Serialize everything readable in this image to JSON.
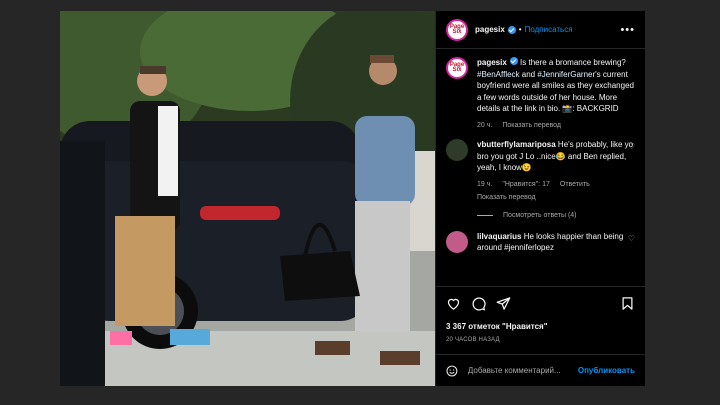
{
  "post": {
    "username": "pagesix",
    "avatar_text": "Page Six",
    "follow_label": "Подписаться",
    "more_label": "•••",
    "separator": "•",
    "caption": {
      "username": "pagesix",
      "t1": " Is there a bromance brewing? ",
      "tag1": "#BenAffleck",
      "t2": " and ",
      "tag2": "#JenniferGarner",
      "t3": "'s current boyfriend were all smiles as they exchanged a few words outside of her house. More details at the link in bio. 📸: BACKGRID",
      "time": "20 ч.",
      "translate": "Показать перевод"
    },
    "comments": [
      {
        "username": "vbutterflylamariposa",
        "text": " He's probably, like yo bro you got J Lo ..nice😂 and Ben replied, yeah, I know😉",
        "time": "19 ч.",
        "likes": "\"Нравится\": 17",
        "reply": "Ответить",
        "translate": "Показать перевод",
        "view_replies": "Посмотреть ответы (4)",
        "avatar_color": "#2f3b2a"
      },
      {
        "username": "lilvaquarius",
        "text": " He looks happier than being around #jenniferlopez",
        "avatar_color": "#c25a8a"
      }
    ],
    "likes_count": "3 367 отметок \"Нравится\"",
    "time_ago": "20 ЧАСОВ НАЗАД",
    "comment_placeholder": "Добавьте комментарий...",
    "publish_label": "Опубликовать"
  },
  "icons": {
    "like": "heart-icon",
    "comment": "comment-icon",
    "share": "share-icon",
    "save": "bookmark-icon",
    "emoji": "emoji-icon",
    "options": "more-options-icon"
  },
  "colors": {
    "accent": "#0095f6",
    "background": "#000000",
    "muted": "#a8a8a8",
    "overlay": "#262626"
  }
}
